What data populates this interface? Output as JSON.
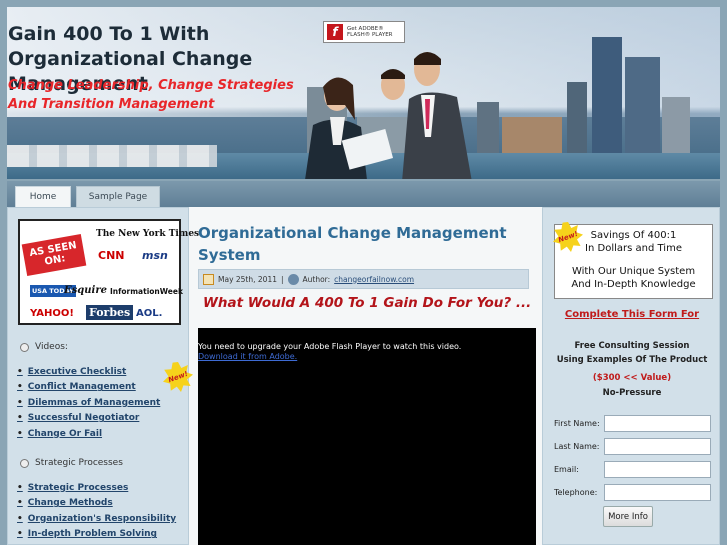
{
  "header": {
    "site_title": "Gain 400 To 1 With Organizational Change Management",
    "tagline": "Change Leadership, Change Strategies And Transition Management",
    "flash_badge": {
      "line1": "Get ADOBE®",
      "line2": "FLASH® PLAYER"
    }
  },
  "nav": {
    "tabs": [
      {
        "label": "Home",
        "active": true
      },
      {
        "label": "Sample Page",
        "active": false
      }
    ]
  },
  "left_sidebar": {
    "as_seen_on": {
      "ribbon": "AS SEEN ON:",
      "logos": [
        "The New York Times",
        "CNN",
        "msn",
        "USA TODAY",
        "Esquire",
        "InformationWeek",
        "YAHOO!",
        "Forbes",
        "AOL."
      ]
    },
    "new_badge": "New!",
    "sections": [
      {
        "heading": "Videos:",
        "items": [
          "Executive Checklist",
          "Conflict Management",
          "Dilemmas of Management",
          "Successful Negotiator",
          "Change Or Fail"
        ]
      },
      {
        "heading": "Strategic Processes",
        "items": [
          "Strategic Processes",
          "Change Methods",
          "Organization's Responsibility",
          "In-depth Problem Solving"
        ]
      }
    ]
  },
  "post": {
    "title": "Organizational Change Management System",
    "date": "May 25th, 2011",
    "author_label": "Author:",
    "author": "changeorfailnow.com",
    "headline": "What Would A 400 To 1 Gain Do For You? ...",
    "video_message": "You need to upgrade your Adobe Flash Player to watch this video.",
    "video_link": "Download it from Adobe."
  },
  "right_sidebar": {
    "new_badge": "New!",
    "promo_line1": "Savings Of 400:1",
    "promo_line2": "In Dollars and Time",
    "promo_line3": "With Our Unique System",
    "promo_line4": "And In-Depth Knowledge",
    "cta_title": "Complete This Form For",
    "cta_line1": "Free Consulting Session",
    "cta_line2": "Using Examples Of The Product",
    "cta_value": "($300  << Value)",
    "cta_line3": "No-Pressure",
    "form": {
      "first_name_label": "First Name:",
      "last_name_label": "Last Name:",
      "email_label": "Email:",
      "telephone_label": "Telephone:",
      "submit_label": "More Info"
    }
  },
  "colors": {
    "accent": "#2f6b96",
    "cta_red": "#c01a1a",
    "tagline_red": "#e8262a",
    "sidebar_bg": "#d2e0e9"
  }
}
